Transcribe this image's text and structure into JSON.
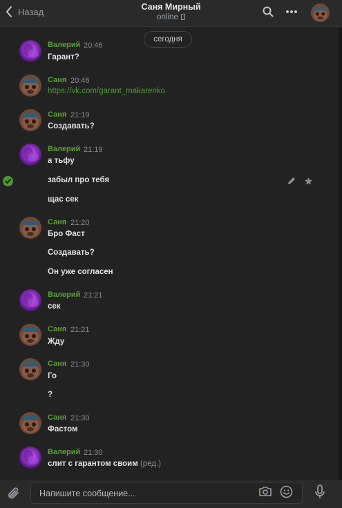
{
  "header": {
    "back_label": "Назад",
    "title": "Саня Мирный",
    "status": "online"
  },
  "date_divider": "сегодня",
  "messages": [
    {
      "author": "Валерий",
      "time": "20:46",
      "lines": [
        "Гарант?"
      ]
    },
    {
      "author": "Саня",
      "time": "20:46",
      "lines": [
        "https://vk.com/garant_makarenko"
      ]
    },
    {
      "author": "Саня",
      "time": "21:19",
      "lines": [
        "Создавать?"
      ]
    },
    {
      "author": "Валерий",
      "time": "21:19",
      "lines": [
        "а тьфу",
        "забыл про тебя",
        "щас сек"
      ]
    },
    {
      "author": "Саня",
      "time": "21:20",
      "lines": [
        "Бро Фаст",
        "Создавать?",
        "Он уже согласен"
      ]
    },
    {
      "author": "Валерий",
      "time": "21:21",
      "lines": [
        "сек"
      ]
    },
    {
      "author": "Саня",
      "time": "21:21",
      "lines": [
        "Жду"
      ]
    },
    {
      "author": "Саня",
      "time": "21:30",
      "lines": [
        "Го",
        "?"
      ]
    },
    {
      "author": "Саня",
      "time": "21:30",
      "lines": [
        "Фастом"
      ]
    },
    {
      "author": "Валерий",
      "time": "21:30",
      "lines": [
        "слит с гарантом своим"
      ],
      "edited": "(ред.)"
    }
  ],
  "composer": {
    "placeholder": "Напишите сообщение..."
  },
  "colors": {
    "background": "#222222",
    "author_name": "#5b9e3a",
    "link": "#4f9a32",
    "check": "#4a9a2e"
  },
  "icons": [
    "chevron-left-icon",
    "search-icon",
    "more-icon",
    "pencil-icon",
    "star-icon",
    "check-icon",
    "paperclip-icon",
    "camera-icon",
    "smile-icon",
    "microphone-icon"
  ]
}
